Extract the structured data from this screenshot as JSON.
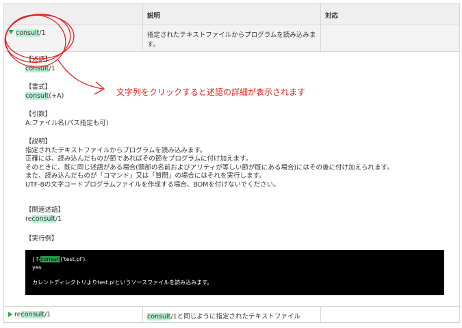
{
  "headers": [
    "",
    "説明",
    "対応"
  ],
  "rows": [
    {
      "pred": "consult",
      "arity": "/1",
      "desc": "指定されたテキストファイルからプログラムを読み込みます。",
      "support": ""
    }
  ],
  "detail": {
    "sec_predicate": "【述語】",
    "predicate_hl": "consult",
    "predicate_rest": "/1",
    "sec_format": "【書式】",
    "format_hl": "consult",
    "format_rest": "(+A)",
    "sec_args": "【引数】",
    "args": "A:ファイル名(パス指定も可)",
    "sec_desc": "【説明】",
    "desc_lines": [
      "指定されたテキストファイルからプログラムを読み込みます。",
      "正確には、読み込んだものが節であればその節をプログラムに付け加えます。",
      "そのときに、既に同じ述語がある場合(頭部の名前およびアリティが等しい節が既にある場合)にはその後に付け加えられます。",
      "また、読み込んだものが「コマンド」又は「質問」の場合にはそれを実行します。",
      "UTF-8の文字コードプログラムファイルを作成する場合、BOMを付けないでください。"
    ],
    "sec_related": "【関連述語】",
    "related_pre": "re",
    "related_hl": "consult",
    "related_rest": "/1",
    "sec_example": "【実行例】",
    "code_prompt": "| ?-",
    "code_kw": "consult",
    "code_rest": "('test.pl').",
    "code_yes": "yes",
    "code_note": "カレントディレクトリよりtest.plというソースファイルを読み込みます。"
  },
  "row2": {
    "pre": "re",
    "hl": "consult",
    "rest": "/1",
    "desc_hl": "consult",
    "desc_rest": "/1と同じように指定されたテキストファイル"
  },
  "annotation": "文字列をクリックすると述語の詳細が表示されます",
  "colors": {
    "highlight": "#b9f0d4",
    "annotation": "#e02020",
    "arrow": "#33aa33"
  }
}
